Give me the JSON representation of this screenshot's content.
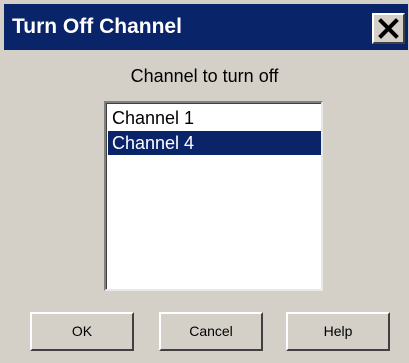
{
  "window": {
    "title": "Turn Off Channel",
    "close_icon": "close-icon"
  },
  "main": {
    "heading": "Channel to turn off",
    "channels": [
      {
        "label": "Channel 1",
        "selected": false
      },
      {
        "label": "Channel 4",
        "selected": true
      }
    ]
  },
  "buttons": {
    "ok": "OK",
    "cancel": "Cancel",
    "help": "Help"
  },
  "colors": {
    "titlebar": "#0a246a",
    "selection": "#0a246a",
    "face": "#d4d0c8"
  }
}
